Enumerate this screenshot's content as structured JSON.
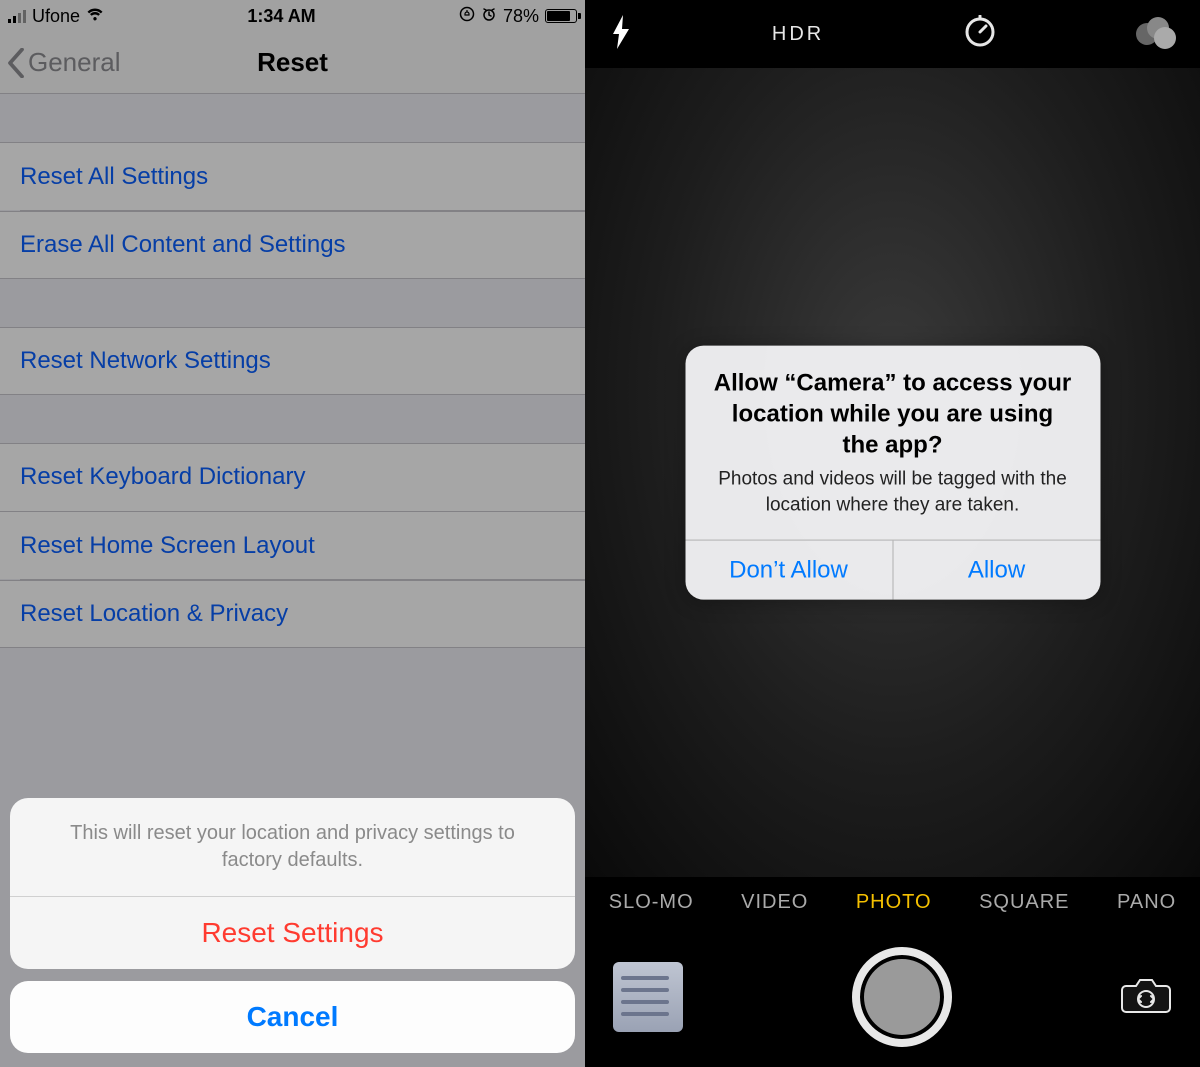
{
  "left": {
    "status": {
      "carrier": "Ufone",
      "time": "1:34 AM",
      "battery_pct": "78%"
    },
    "nav": {
      "back": "General",
      "title": "Reset"
    },
    "groups": [
      [
        "Reset All Settings",
        "Erase All Content and Settings"
      ],
      [
        "Reset Network Settings"
      ],
      [
        "Reset Keyboard Dictionary",
        "Reset Home Screen Layout",
        "Reset Location & Privacy"
      ]
    ],
    "sheet": {
      "message": "This will reset your location and privacy settings to factory defaults.",
      "destructive": "Reset Settings",
      "cancel": "Cancel"
    }
  },
  "right": {
    "hdr_label": "HDR",
    "modes": [
      "SLO-MO",
      "VIDEO",
      "PHOTO",
      "SQUARE",
      "PANO"
    ],
    "selected_mode_index": 2,
    "alert": {
      "title": "Allow “Camera” to access your location while you are using the app?",
      "message": "Photos and videos will be tagged with the location where they are taken.",
      "deny": "Don’t Allow",
      "allow": "Allow"
    }
  }
}
